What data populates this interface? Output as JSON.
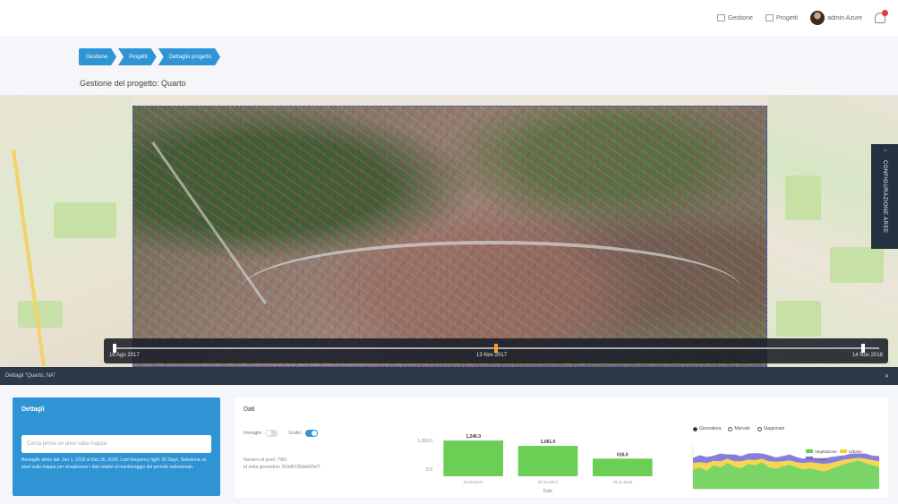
{
  "topbar": {
    "items": [
      {
        "label": "Gestione",
        "icon": "cart-icon"
      },
      {
        "label": "Progetti",
        "icon": "folder-icon"
      },
      {
        "label": "admin Azure"
      }
    ],
    "notification_count": ""
  },
  "breadcrumb": [
    "Gestione",
    "Progetti",
    "Dettaglio progetto"
  ],
  "page": {
    "title": "Gestione del progetto: Quarto"
  },
  "timeline": {
    "start": "16 Ago 2017",
    "mid": "13 Nov 2017",
    "end": "14 Nov 2018"
  },
  "config_tab": {
    "label": "CONFIGURAZIONE AREE"
  },
  "panel_bar": {
    "label": "Dettagli \"Quarto, NA\""
  },
  "details": {
    "title": "Dettagli",
    "input_placeholder": "Cerca prima un pixel sulla mappa",
    "description": "Bersaglio attivo dal: Jan 1, 2018 al Dec 30, 2018. Last frequency light: 30 Days. Seleziona un pixel sulla mappa per visualizzare i dati relativi al monitoraggio del periodo selezionato."
  },
  "data_panel": {
    "title": "Dati",
    "toggle_left": "Immagini",
    "toggle_right": "Grafici",
    "stat1": "Numero di pixel: 7981",
    "stat2": "Id della geometria: 2b9d6735bbb60ef7"
  },
  "chart_data": [
    {
      "type": "bar",
      "categories": [
        "10.08.2017",
        "03.12.2017",
        "19.11.2018"
      ],
      "values": [
        1246,
        1061,
        616
      ],
      "data_labels": [
        "1,246.0",
        "1,061.0",
        "616.0"
      ],
      "ylim": [
        0,
        1250
      ],
      "ytick_labels": [
        "1,250.0",
        "0.0"
      ],
      "xlabel": "Date",
      "colors": [
        "#6ccf55"
      ]
    },
    {
      "type": "area",
      "legend_top": [
        "Giornaliera",
        "Mensile",
        "Stagionale"
      ],
      "legend_selected": "Giornaliera",
      "series": [
        {
          "name": "Vegetazione",
          "color": "#6ccf55",
          "values": [
            0.45,
            0.5,
            0.42,
            0.55,
            0.5,
            0.6,
            0.52,
            0.48,
            0.58,
            0.55,
            0.62,
            0.5,
            0.47,
            0.52,
            0.56,
            0.5,
            0.45,
            0.48,
            0.44,
            0.4,
            0.46,
            0.52,
            0.58,
            0.62,
            0.66,
            0.6,
            0.55,
            0.5
          ]
        },
        {
          "name": "Urbano",
          "color": "#f5d03c",
          "values": [
            0.15,
            0.12,
            0.18,
            0.1,
            0.14,
            0.1,
            0.12,
            0.16,
            0.1,
            0.12,
            0.08,
            0.14,
            0.16,
            0.12,
            0.1,
            0.12,
            0.15,
            0.14,
            0.16,
            0.18,
            0.14,
            0.12,
            0.1,
            0.08,
            0.06,
            0.1,
            0.12,
            0.14
          ]
        },
        {
          "name": "Acqua",
          "color": "#7a6fd8",
          "values": [
            0.12,
            0.16,
            0.14,
            0.12,
            0.18,
            0.1,
            0.16,
            0.12,
            0.14,
            0.16,
            0.12,
            0.14,
            0.1,
            0.12,
            0.14,
            0.12,
            0.1,
            0.12,
            0.1,
            0.12,
            0.14,
            0.12,
            0.1,
            0.12,
            0.1,
            0.12,
            0.1,
            0.12
          ]
        }
      ]
    }
  ]
}
